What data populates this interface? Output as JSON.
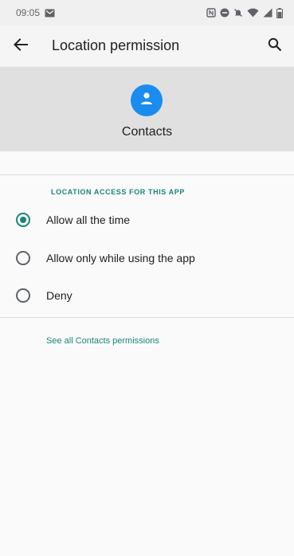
{
  "status_bar": {
    "time": "09:05",
    "icons": [
      "gmail-icon",
      "nfc-icon",
      "dnd-icon",
      "mute-icon",
      "wifi-icon",
      "signal-icon",
      "battery-icon"
    ]
  },
  "app_bar": {
    "title": "Location permission",
    "back_icon": "arrow-back-icon",
    "search_icon": "search-icon"
  },
  "app_header": {
    "name": "Contacts",
    "icon": "person-icon",
    "icon_color": "#1a8cf0"
  },
  "section": {
    "header": "LOCATION ACCESS FOR THIS APP",
    "accent_color": "#1a857a"
  },
  "options": [
    {
      "label": "Allow all the time",
      "selected": true
    },
    {
      "label": "Allow only while using the app",
      "selected": false
    },
    {
      "label": "Deny",
      "selected": false
    }
  ],
  "footer_link": "See all Contacts permissions"
}
